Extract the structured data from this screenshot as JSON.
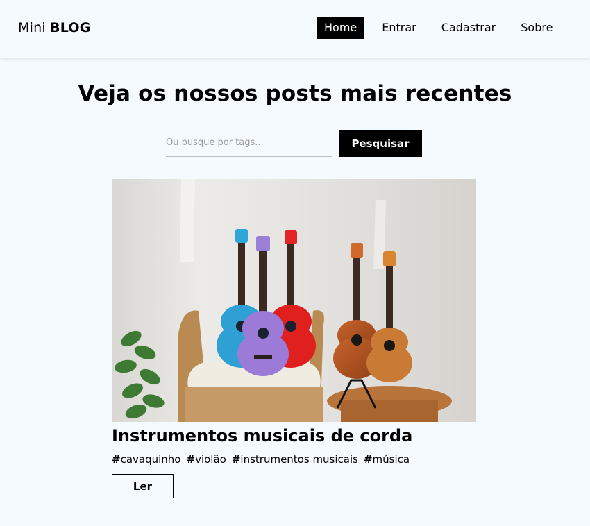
{
  "brand": {
    "light": "Mini ",
    "bold": "BLOG"
  },
  "nav": {
    "items": [
      {
        "label": "Home",
        "active": true
      },
      {
        "label": "Entrar",
        "active": false
      },
      {
        "label": "Cadastrar",
        "active": false
      },
      {
        "label": "Sobre",
        "active": false
      }
    ]
  },
  "main": {
    "title": "Veja os nossos posts mais recentes"
  },
  "search": {
    "placeholder": "Ou busque por tags...",
    "value": "",
    "button_label": "Pesquisar"
  },
  "posts": [
    {
      "title": "Instrumentos musicais de corda",
      "tags": [
        "cavaquinho",
        "violão",
        "instrumentos musicais",
        "música"
      ],
      "read_label": "Ler",
      "image_subject": "ukuleles-photo"
    }
  ],
  "colors": {
    "background": "#f5faff",
    "primary": "#000000",
    "on_primary": "#ffffff"
  }
}
